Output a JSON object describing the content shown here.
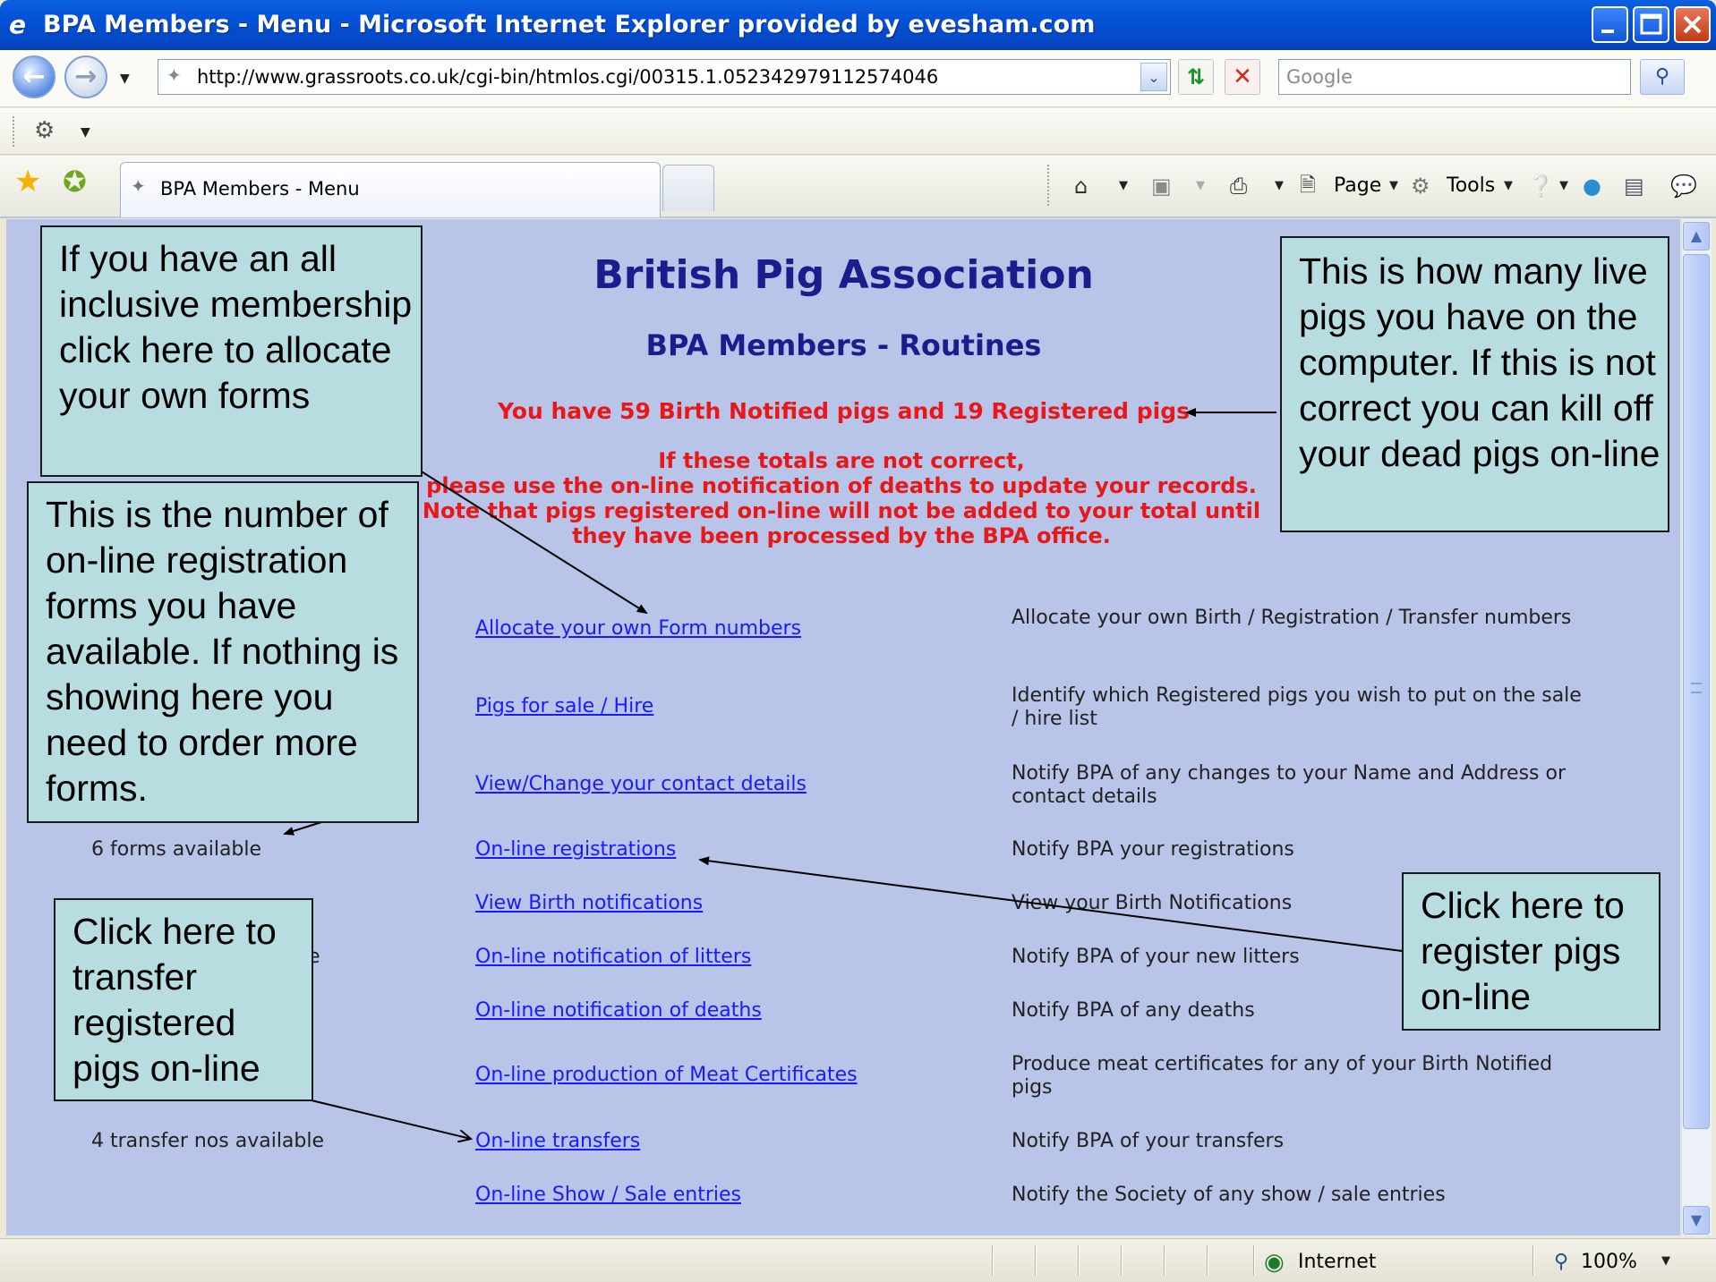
{
  "window": {
    "title": "BPA Members - Menu - Microsoft Internet Explorer provided by evesham.com",
    "app_icon": "ie-icon",
    "minimize": "minimize-icon",
    "maximize": "maximize-icon",
    "close": "close-icon"
  },
  "address_bar": {
    "url": "http://www.grassroots.co.uk/cgi-bin/htmlos.cgi/00315.1.052342979112574046",
    "search_placeholder": "Google"
  },
  "tab": {
    "label": "BPA Members - Menu"
  },
  "command_bar": {
    "page_label": "Page",
    "tools_label": "Tools"
  },
  "page": {
    "title": "British Pig Association",
    "subtitle": "BPA Members - Routines",
    "pig_count": "You have 59 Birth Notified pigs and 19 Registered pigs",
    "warning_lines": [
      "If these totals are not correct,",
      "please use the on-line notification of deaths to update your records.",
      "Note that pigs registered on-line will not be added to your total until",
      "they have been processed by the BPA office."
    ],
    "menu": [
      {
        "link": "Allocate your own Form numbers",
        "desc": "Allocate your own Birth / Registration / Transfer numbers"
      },
      {
        "link": "Pigs for sale / Hire",
        "desc": "Identify which Registered pigs you wish to put on the sale / hire list"
      },
      {
        "link": "View/Change your contact details",
        "desc": "Notify BPA of any changes to your Name and Address or contact details"
      },
      {
        "link": "On-line registrations",
        "desc": "Notify BPA your registrations"
      },
      {
        "link": "View Birth notifications",
        "desc": "View your Birth Notifications"
      },
      {
        "link": "On-line notification of litters",
        "desc": "Notify BPA of your new litters"
      },
      {
        "link": "On-line notification of deaths",
        "desc": "Notify BPA of any deaths"
      },
      {
        "link": "On-line production of Meat Certificates",
        "desc": "Produce meat certificates for any of your Birth Notified pigs"
      },
      {
        "link": "On-line transfers",
        "desc": "Notify BPA of your transfers"
      },
      {
        "link": "On-line Show / Sale entries",
        "desc": "Notify the Society of any show / sale entries"
      }
    ],
    "forms_available": "6 forms available",
    "litters_side_fragment": "e",
    "transfer_available": "4 transfer nos available"
  },
  "callouts": {
    "allocate": "If you have an all inclusive membership click here to allocate your own forms",
    "forms": "This is the number of on-line registration forms you have available. If nothing is showing here you need to order more forms.",
    "transfer": "Click here to transfer registered pigs on-line",
    "live_pigs": "This is how many live pigs you have on the computer. If this is not correct you can kill off your dead pigs on-line",
    "register": "Click here to register pigs on-line"
  },
  "status_bar": {
    "zone": "Internet",
    "zoom": "100%"
  },
  "colors": {
    "content_bg": "#b8c4e8",
    "heading": "#1c1c8c",
    "alert": "#e8171a",
    "link": "#1a1aff",
    "callout_bg": "#b7dde0"
  }
}
